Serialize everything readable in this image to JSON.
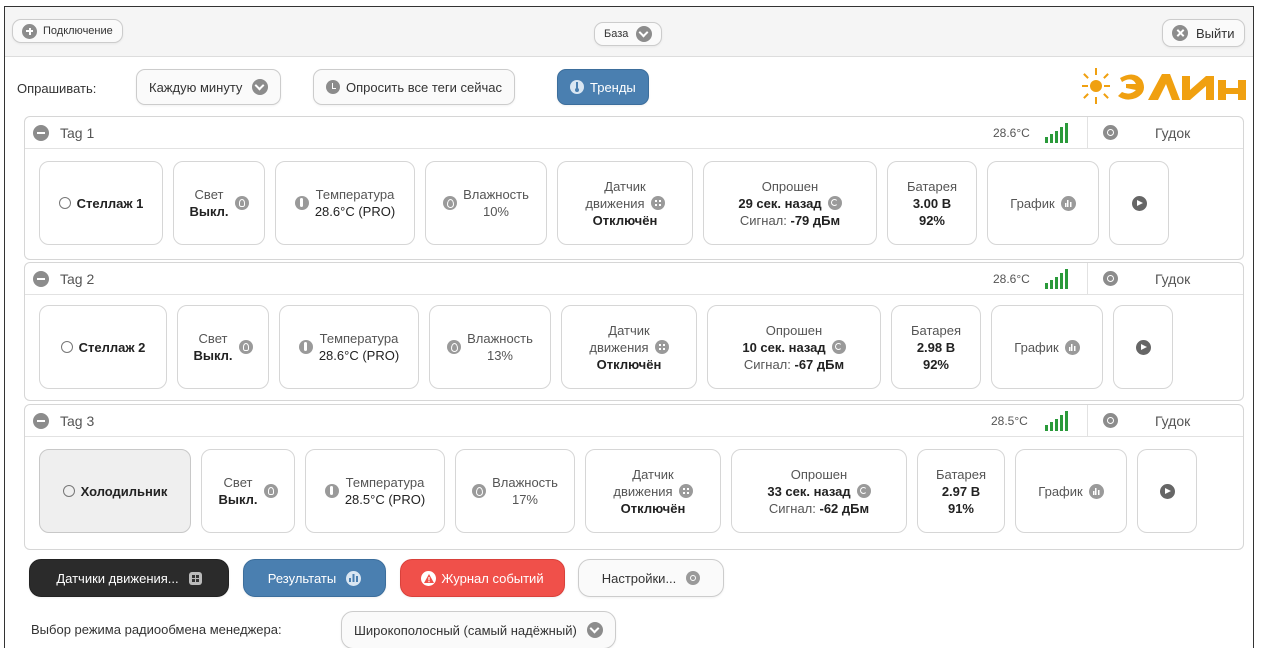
{
  "topbar": {
    "connect_label": "Подключение",
    "db_label": "База",
    "logout_label": "Выйти"
  },
  "toolbar": {
    "poll_label": "Опрашивать:",
    "poll_interval": "Каждую минуту",
    "poll_all_label": "Опросить все теги сейчас",
    "trends_label": "Тренды"
  },
  "labels": {
    "light": "Свет",
    "temperature": "Температура",
    "humidity": "Влажность",
    "motion_line1": "Датчик",
    "motion_line2": "движения",
    "polled": "Опрошен",
    "signal": "Сигнал:",
    "battery": "Батарея",
    "graph": "График",
    "beep": "Гудок"
  },
  "tags": [
    {
      "name": "Tag 1",
      "header_temp": "28.6°C",
      "location": "Стеллаж 1",
      "light": "Выкл.",
      "temperature": "28.6°C (PRO)",
      "humidity": "10%",
      "motion": "Отключён",
      "polled_ago": "29 сек. назад",
      "signal": "-79 дБм",
      "battery_v": "3.00 В",
      "battery_pct": "92%"
    },
    {
      "name": "Tag 2",
      "header_temp": "28.6°C",
      "location": "Стеллаж 2",
      "light": "Выкл.",
      "temperature": "28.6°C (PRO)",
      "humidity": "13%",
      "motion": "Отключён",
      "polled_ago": "10 сек. назад",
      "signal": "-67 дБм",
      "battery_v": "2.98 В",
      "battery_pct": "92%"
    },
    {
      "name": "Tag 3",
      "header_temp": "28.5°C",
      "location": "Холодильник",
      "light": "Выкл.",
      "temperature": "28.5°C (PRO)",
      "humidity": "17%",
      "motion": "Отключён",
      "polled_ago": "33 сек. назад",
      "signal": "-62 дБм",
      "battery_v": "2.97 В",
      "battery_pct": "91%"
    }
  ],
  "bottom": {
    "motion_sensors_label": "Датчики движения...",
    "results_label": "Результаты",
    "event_log_label": "Журнал событий",
    "settings_label": "Настройки...",
    "radio_mode_label": "Выбор режима радиообмена менеджера:",
    "radio_mode_value": "Широкополосный (самый надёжный)"
  },
  "colors": {
    "accent_blue": "#4a7fb0",
    "alert_red": "#f0504a",
    "dark": "#2b2b2b",
    "signal_green": "#2a9a3a",
    "logo_orange": "#f0a010"
  }
}
